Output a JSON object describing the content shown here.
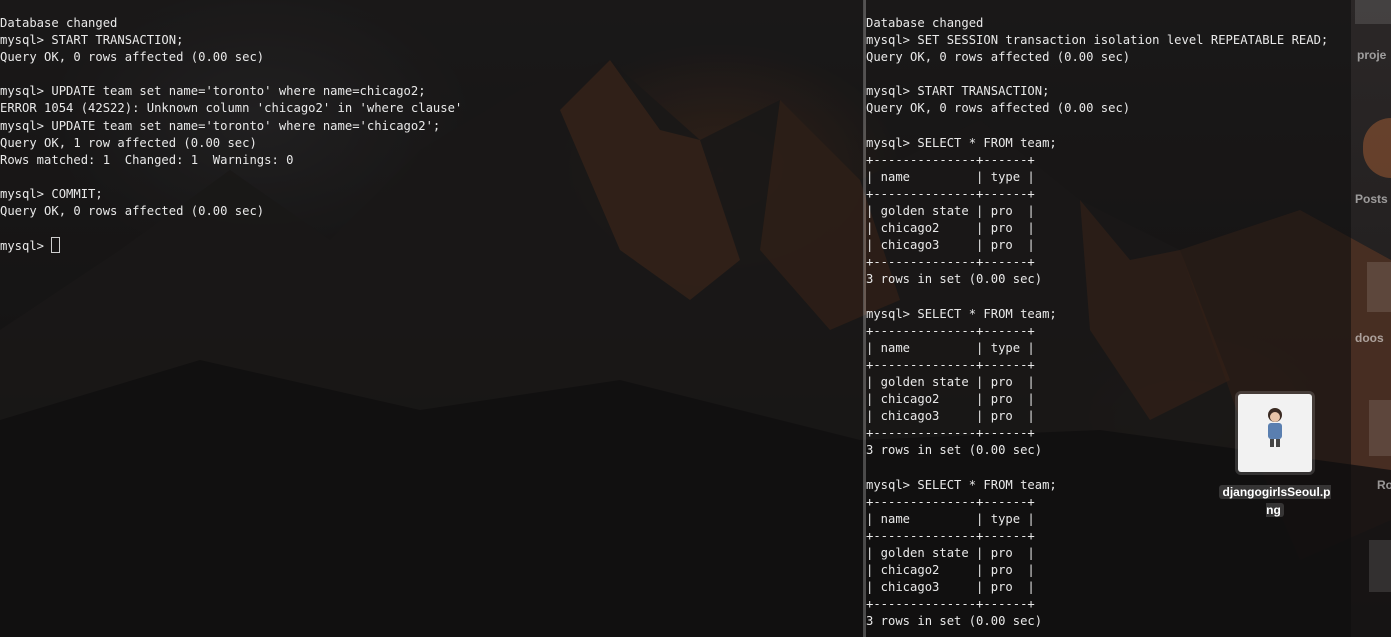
{
  "left_terminal": {
    "lines": [
      "Database changed",
      "mysql> START TRANSACTION;",
      "Query OK, 0 rows affected (0.00 sec)",
      "",
      "mysql> UPDATE team set name='toronto' where name=chicago2;",
      "ERROR 1054 (42S22): Unknown column 'chicago2' in 'where clause'",
      "mysql> UPDATE team set name='toronto' where name='chicago2';",
      "Query OK, 1 row affected (0.00 sec)",
      "Rows matched: 1  Changed: 1  Warnings: 0",
      "",
      "mysql> COMMIT;",
      "Query OK, 0 rows affected (0.00 sec)",
      ""
    ],
    "prompt": "mysql> "
  },
  "right_terminal": {
    "lines": [
      "Database changed",
      "mysql> SET SESSION transaction isolation level REPEATABLE READ;",
      "Query OK, 0 rows affected (0.00 sec)",
      "",
      "mysql> START TRANSACTION;",
      "Query OK, 0 rows affected (0.00 sec)",
      "",
      "mysql> SELECT * FROM team;",
      "+--------------+------+",
      "| name         | type |",
      "+--------------+------+",
      "| golden state | pro  |",
      "| chicago2     | pro  |",
      "| chicago3     | pro  |",
      "+--------------+------+",
      "3 rows in set (0.00 sec)",
      "",
      "mysql> SELECT * FROM team;",
      "+--------------+------+",
      "| name         | type |",
      "+--------------+------+",
      "| golden state | pro  |",
      "| chicago2     | pro  |",
      "| chicago3     | pro  |",
      "+--------------+------+",
      "3 rows in set (0.00 sec)",
      "",
      "mysql> SELECT * FROM team;",
      "+--------------+------+",
      "| name         | type |",
      "+--------------+------+",
      "| golden state | pro  |",
      "| chicago2     | pro  |",
      "| chicago3     | pro  |",
      "+--------------+------+",
      "3 rows in set (0.00 sec)"
    ]
  },
  "desktop": {
    "labels": [
      "proje",
      "Posts",
      "doos",
      "Ro"
    ],
    "file_name": "djangogirlsSeoul.p\nng",
    "file_icon": "image-file-icon"
  }
}
